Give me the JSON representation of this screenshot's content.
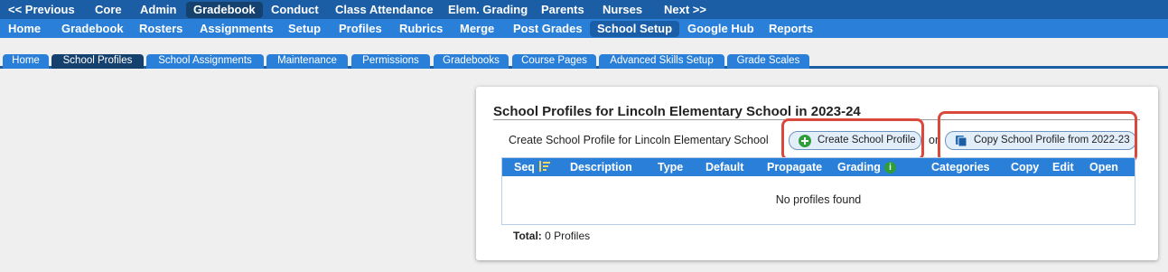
{
  "top_nav": {
    "items": [
      {
        "label": "<< Previous"
      },
      {
        "label": "Core"
      },
      {
        "label": "Admin"
      },
      {
        "label": "Gradebook",
        "active": true
      },
      {
        "label": "Conduct"
      },
      {
        "label": "Class Attendance"
      },
      {
        "label": "Elem. Grading"
      },
      {
        "label": "Parents"
      },
      {
        "label": "Nurses"
      },
      {
        "label": "Next >>"
      }
    ]
  },
  "sub_nav": {
    "items": [
      {
        "label": "Home"
      },
      {
        "label": "Gradebook"
      },
      {
        "label": "Rosters"
      },
      {
        "label": "Assignments"
      },
      {
        "label": "Setup"
      },
      {
        "label": "Profiles"
      },
      {
        "label": "Rubrics"
      },
      {
        "label": "Merge"
      },
      {
        "label": "Post Grades"
      },
      {
        "label": "School Setup",
        "active": true
      },
      {
        "label": "Google Hub"
      },
      {
        "label": "Reports"
      }
    ]
  },
  "tabs": [
    {
      "label": "Home"
    },
    {
      "label": "School Profiles",
      "active": true
    },
    {
      "label": "School Assignments"
    },
    {
      "label": "Maintenance"
    },
    {
      "label": "Permissions"
    },
    {
      "label": "Gradebooks"
    },
    {
      "label": "Course Pages"
    },
    {
      "label": "Advanced Skills Setup"
    },
    {
      "label": "Grade Scales"
    }
  ],
  "panel": {
    "title": "School Profiles for Lincoln Elementary School in 2023-24",
    "create_text": "Create School Profile for Lincoln Elementary School",
    "or_text": "or",
    "create_button": "Create School Profile",
    "copy_button": "Copy School Profile from 2022-23",
    "table": {
      "headers": [
        "Seq",
        "Description",
        "Type",
        "Default",
        "Propagate",
        "Grading",
        "Categories",
        "Copy",
        "Edit",
        "Open"
      ],
      "empty_message": "No profiles found"
    },
    "total_label": "Total:",
    "total_value": "0 Profiles"
  },
  "colors": {
    "top_nav_bg": "#1c5ea6",
    "sub_nav_bg": "#2a7fd9",
    "active_tab_bg": "#15416f",
    "highlight": "#d9493c",
    "info_icon": "#2e9e3a"
  },
  "icons": {
    "create": "plus-circle-icon",
    "copy": "copy-icon",
    "sort": "sort-icon",
    "info": "info-icon"
  }
}
